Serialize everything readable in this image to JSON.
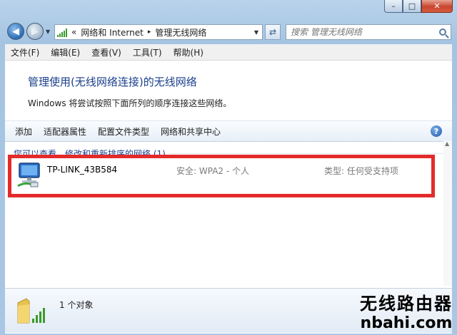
{
  "window": {
    "minimize_label": "–",
    "maximize_label": "□",
    "close_label": "✕"
  },
  "navigation": {
    "back_icon": "back-arrow-icon",
    "forward_icon": "forward-arrow-icon",
    "breadcrumb_overflow": "«",
    "breadcrumb": [
      "网络和 Internet",
      "管理无线网络"
    ],
    "separator": "▸",
    "search_placeholder": "搜索 管理无线网络"
  },
  "menu": {
    "file": "文件(F)",
    "edit": "编辑(E)",
    "view": "查看(V)",
    "tools": "工具(T)",
    "help": "帮助(H)"
  },
  "content": {
    "heading": "管理使用(无线网络连接)的无线网络",
    "description": "Windows 将尝试按照下面所列的顺序连接这些网络。"
  },
  "toolbar": {
    "add": "添加",
    "adapter_properties": "适配器属性",
    "profile_types": "配置文件类型",
    "network_center": "网络和共享中心",
    "help": "?"
  },
  "network_list": {
    "group_header": "您可以查看、修改和重新排序的网络 (1)",
    "networks": [
      {
        "name": "TP-LINK_43B584",
        "security": "安全: WPA2 - 个人",
        "type": "类型: 任何受支持项",
        "icon": "wireless-network-icon"
      }
    ]
  },
  "status_bar": {
    "text": "1 个对象",
    "icon": "wireless-folder-icon"
  },
  "watermark": {
    "line1": "无线路由器",
    "line2": "nbahi.com"
  },
  "colors": {
    "heading": "#1a3e8c",
    "highlight": "#e42a2a",
    "signal": "#3a9a2b"
  }
}
